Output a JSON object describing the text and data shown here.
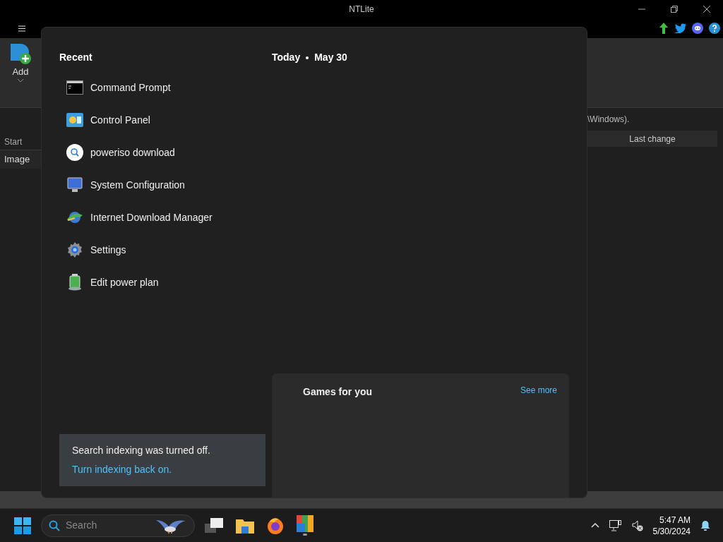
{
  "window": {
    "title": "NTLite"
  },
  "ribbon": {
    "add_label": "Add"
  },
  "path_text": "\\Windows).",
  "sidebar": {
    "section": "Start",
    "item": "Image"
  },
  "table": {
    "columns": [
      "Last change"
    ]
  },
  "start_menu": {
    "recent_title": "Recent",
    "recent": [
      {
        "label": "Command Prompt",
        "kind": "terminal"
      },
      {
        "label": "Control Panel",
        "kind": "control-panel"
      },
      {
        "label": "poweriso download",
        "kind": "web-search"
      },
      {
        "label": "System Configuration",
        "kind": "system-config"
      },
      {
        "label": "Internet Download Manager",
        "kind": "download-manager"
      },
      {
        "label": "Settings",
        "kind": "settings"
      },
      {
        "label": "Edit power plan",
        "kind": "battery"
      }
    ],
    "today": "Today",
    "date": "May 30",
    "games": {
      "title": "Games for you",
      "link": "See more"
    },
    "notice": {
      "message": "Search indexing was turned off.",
      "link": "Turn indexing back on."
    }
  },
  "taskbar": {
    "search": {
      "placeholder": "Search"
    },
    "time": "5:47 AM",
    "date": "5/30/2024"
  }
}
